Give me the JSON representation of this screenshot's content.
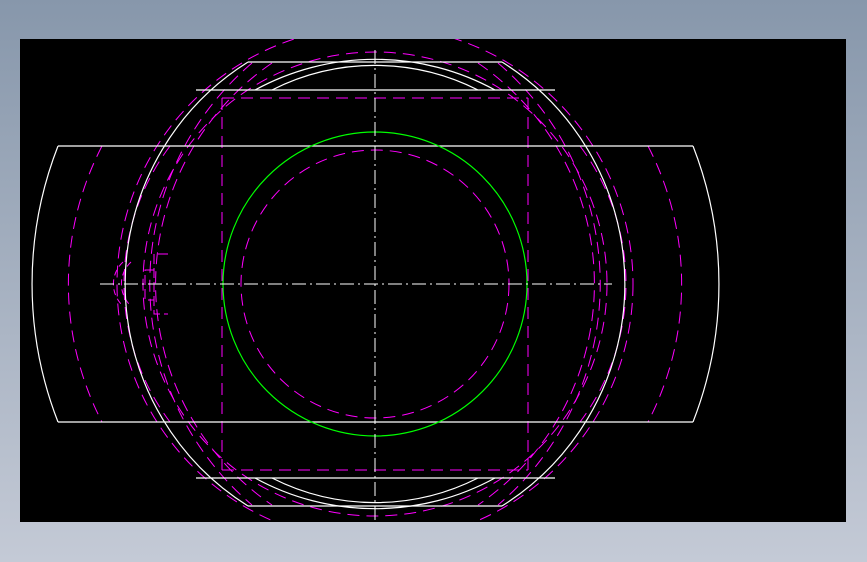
{
  "drawing": {
    "background_color": "#000000",
    "page_gradient": [
      "#8797ab",
      "#c4cad6"
    ],
    "colors": {
      "outline": "#ffffff",
      "hidden": "#ff00ff",
      "bore": "#00ff00",
      "centerline": "#ffffff"
    },
    "views": [
      "front-view"
    ],
    "linetypes": [
      "continuous",
      "dashed",
      "dash-dot"
    ]
  }
}
